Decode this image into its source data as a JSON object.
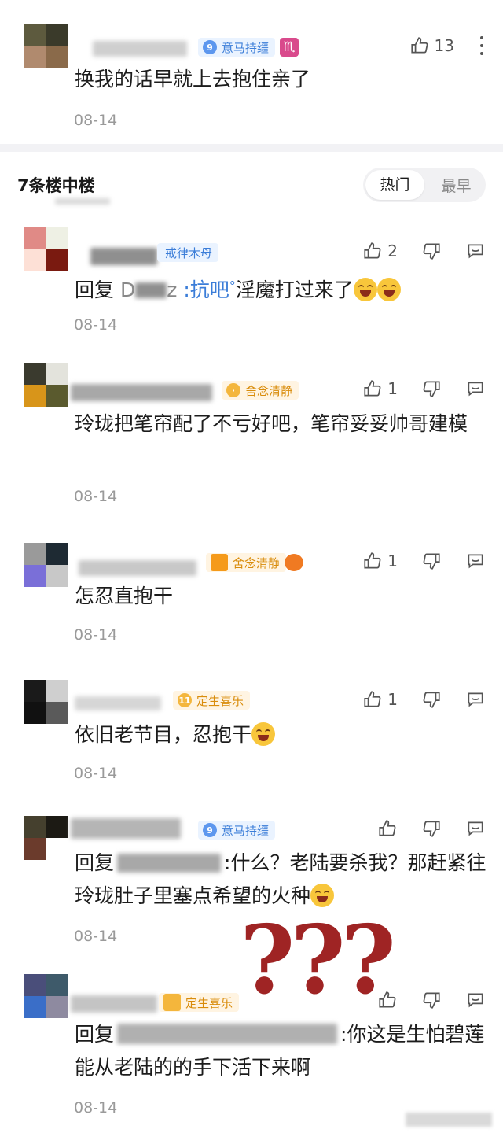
{
  "top_comment": {
    "badge": "意马持缰",
    "badge_level": "9",
    "likes": "13",
    "text": "换我的话早就上去抱住亲了",
    "date": "08-14"
  },
  "thread": {
    "count_label": "7条楼中楼",
    "sort_options": [
      "热门",
      "最早"
    ],
    "active_sort": "热门"
  },
  "replies": [
    {
      "badge": "戒律木母",
      "badge_level": "",
      "likes": "2",
      "prefix": "回复",
      "reply_to": "D",
      "reply_to2": "z",
      "link_text": ":抗吧",
      "text": "淫魔打过来了",
      "date": "08-14"
    },
    {
      "badge": "舍念清静",
      "badge_level": "",
      "likes": "1",
      "text": "玲珑把笔帘配了不亏好吧，笔帘妥妥帅哥建模",
      "date": "08-14"
    },
    {
      "badge": "舍念清静",
      "badge_level": "",
      "likes": "1",
      "text": "怎忍直抱干",
      "date": "08-14"
    },
    {
      "badge": "定生喜乐",
      "badge_level": "11",
      "likes": "1",
      "text": "依旧老节目，忍抱干",
      "date": "08-14"
    },
    {
      "badge": "意马持缰",
      "badge_level": "9",
      "likes": "",
      "prefix": "回复",
      "text": ":什么？老陆要杀我？那赶紧往玲珑肚子里塞点希望的火种",
      "date": "08-14"
    },
    {
      "badge": "定生喜乐",
      "badge_level": "",
      "likes": "",
      "prefix": "回复",
      "text": ":你这是生怕碧莲能从老陆的的手下活下来啊",
      "date": "08-14"
    }
  ],
  "overlay": {
    "question_marks": "???"
  },
  "colors": {
    "accent_blue": "#3b7dd8",
    "overlay_red": "#9f2424",
    "date_gray": "#9a9a9a"
  }
}
